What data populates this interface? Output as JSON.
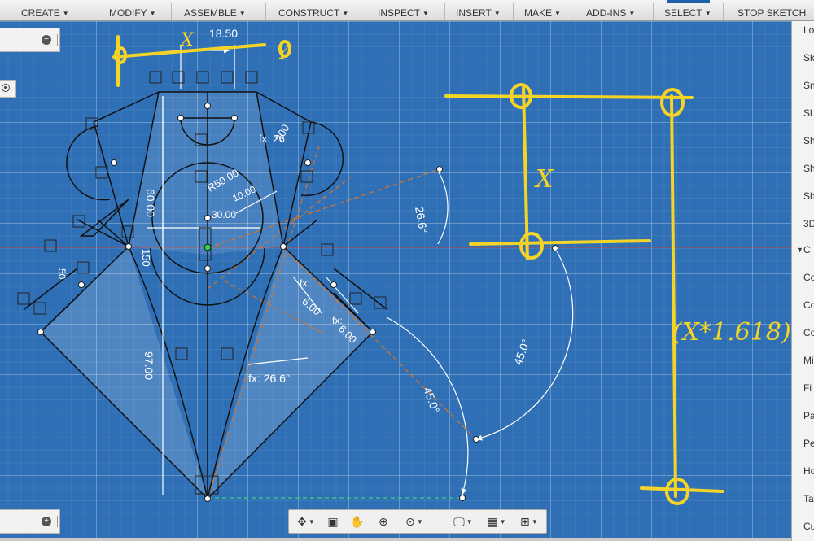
{
  "toolbar": {
    "items": [
      {
        "label": "CREATE"
      },
      {
        "label": "MODIFY"
      },
      {
        "label": "ASSEMBLE"
      },
      {
        "label": "CONSTRUCT"
      },
      {
        "label": "INSPECT"
      },
      {
        "label": "INSERT"
      },
      {
        "label": "MAKE"
      },
      {
        "label": "ADD-INS"
      },
      {
        "label": "SELECT"
      }
    ],
    "stop_sketch": "STOP SKETCH"
  },
  "sketch": {
    "dimensions": {
      "top_width": "18.50",
      "height_60": "60.00",
      "radius_50": "R50.00",
      "dim_10": "10.00",
      "dim_30": "30.00",
      "dim_200": "200",
      "dim_150": "150",
      "dim_97": "97.00",
      "dim_50": "50",
      "dim_6a": "6.00",
      "dim_6b": "6.00",
      "angle_26_top": "26.6°",
      "angle_26_bottom": "fx: 26.6°",
      "angle_45_a": "45.0°",
      "angle_45_b": "45.0°",
      "fx_top": "fx: 26",
      "fx_a": "fx:",
      "fx_b": "fx:"
    },
    "annotations": {
      "x_top": "X",
      "y_top": "Y",
      "x_box": "X",
      "golden": "(X*1.618)"
    },
    "colors": {
      "canvas": "#2e6fb5",
      "lines": "#111111",
      "dims": "#ffffff",
      "construction": "#d2742a",
      "annotation": "#f5d327"
    }
  },
  "navbar": {
    "icons": [
      "orbit-icon",
      "look-at-icon",
      "pan-icon",
      "zoom-icon",
      "zoom-window-icon",
      "display-icon",
      "grid-icon",
      "viewports-icon"
    ]
  },
  "browser": {
    "items": [
      {
        "label": "Lo"
      },
      {
        "label": "Sk"
      },
      {
        "label": "Sn"
      },
      {
        "label": "Sl"
      },
      {
        "label": "Sh"
      },
      {
        "label": "Sh"
      },
      {
        "label": "Sh"
      },
      {
        "label": "3D"
      },
      {
        "label": "C",
        "tri": "▼"
      },
      {
        "label": "Co"
      },
      {
        "label": "Co"
      },
      {
        "label": "Co"
      },
      {
        "label": "Mi"
      },
      {
        "label": "Fi"
      },
      {
        "label": "Pa"
      },
      {
        "label": "Pe"
      },
      {
        "label": "Ho"
      },
      {
        "label": "Ta"
      },
      {
        "label": "Cu"
      }
    ]
  }
}
